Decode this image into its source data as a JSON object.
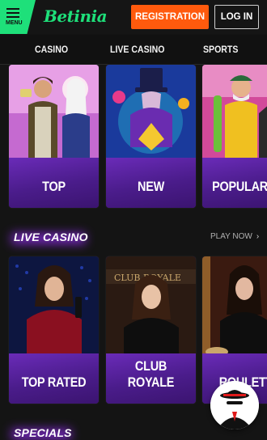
{
  "header": {
    "menu_label": "MENU",
    "logo_text": "Betinia",
    "registration_label": "REGISTRATION",
    "login_label": "LOG IN"
  },
  "nav": {
    "items": [
      "CASINO",
      "LIVE CASINO",
      "SPORTS"
    ]
  },
  "casino_tiles": [
    "TOP",
    "NEW",
    "POPULAR"
  ],
  "live_casino": {
    "title": "LIVE CASINO",
    "play_now": "PLAY NOW",
    "chevron": "›",
    "tiles": [
      "TOP RATED",
      "CLUB ROYALE",
      "ROULETTE"
    ]
  },
  "specials": {
    "title": "SPECIALS"
  },
  "colors": {
    "accent_green": "#1ee07a",
    "registration_orange": "#ff5a0d",
    "tile_purple": "#4b1b87",
    "background": "#141414"
  },
  "icons": [
    "menu-icon",
    "chevron-right-icon",
    "support-agent-icon"
  ]
}
